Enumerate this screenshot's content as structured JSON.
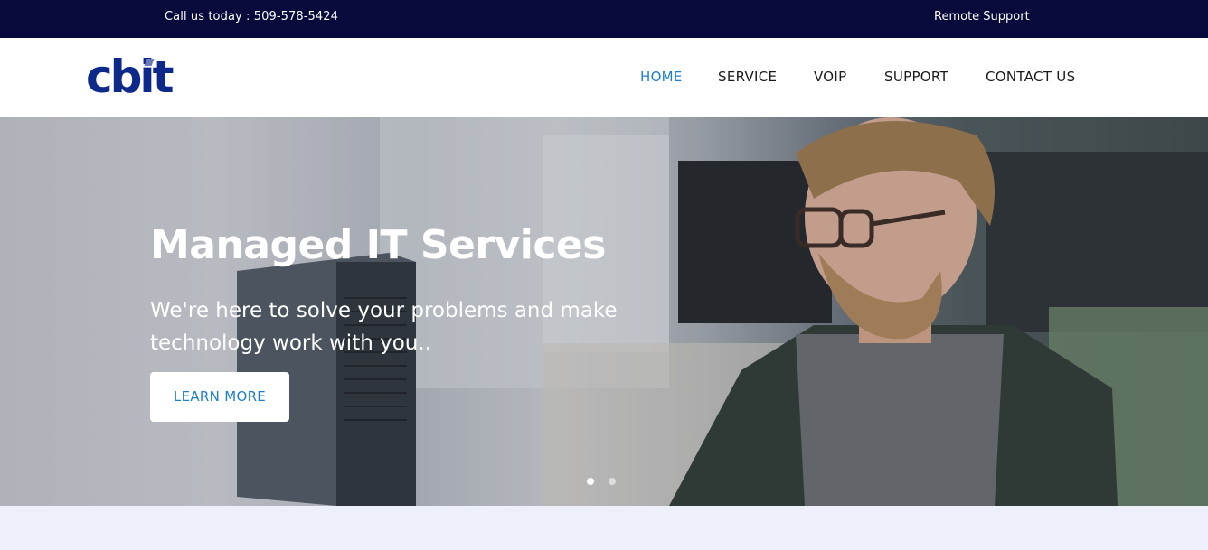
{
  "topbar": {
    "phone_text": "Call us today : 509-578-5424",
    "remote_link": "Remote Support"
  },
  "header": {
    "logo_text": "cbit",
    "nav": [
      {
        "label": "HOME",
        "active": true
      },
      {
        "label": "SERVICE",
        "active": false
      },
      {
        "label": "VOIP",
        "active": false
      },
      {
        "label": "SUPPORT",
        "active": false
      },
      {
        "label": "CONTACT US",
        "active": false
      }
    ]
  },
  "hero": {
    "title": "Managed IT Services",
    "subtitle": "We're here to solve your problems and make technology work with you..",
    "button_label": "LEARN MORE",
    "slides": {
      "count": 2,
      "active_index": 0
    }
  },
  "colors": {
    "topbar_bg": "#070a3b",
    "brand_blue": "#0d2a8a",
    "accent_blue": "#1e7fc9",
    "page_bg": "#edf0fa"
  }
}
